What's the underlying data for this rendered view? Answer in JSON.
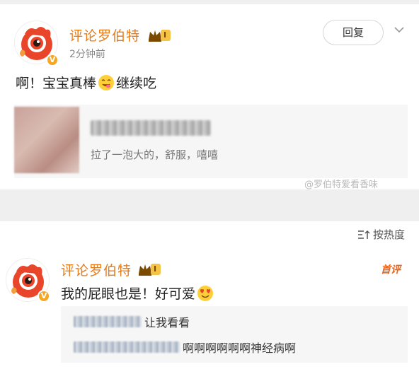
{
  "comment1": {
    "username": "评论罗伯特",
    "level": "I",
    "time": "2分钟前",
    "reply_label": "回复",
    "text_before": "啊！宝宝真棒",
    "text_after": "继续吃",
    "quote_text": "拉了一泡大的，舒服，嘻嘻",
    "watermark": "@罗伯特爱看香味"
  },
  "comment2": {
    "sort_label": "按热度",
    "username": "评论罗伯特",
    "level": "I",
    "hot_badge": "首评",
    "text": "我的屁眼也是！好可爱",
    "sub1_text": "让我看看",
    "sub2_text": "啊啊啊啊啊啊神经病啊"
  },
  "colors": {
    "username": "#e87a16",
    "badge": "#f6c445",
    "hot": "#e8641c"
  }
}
